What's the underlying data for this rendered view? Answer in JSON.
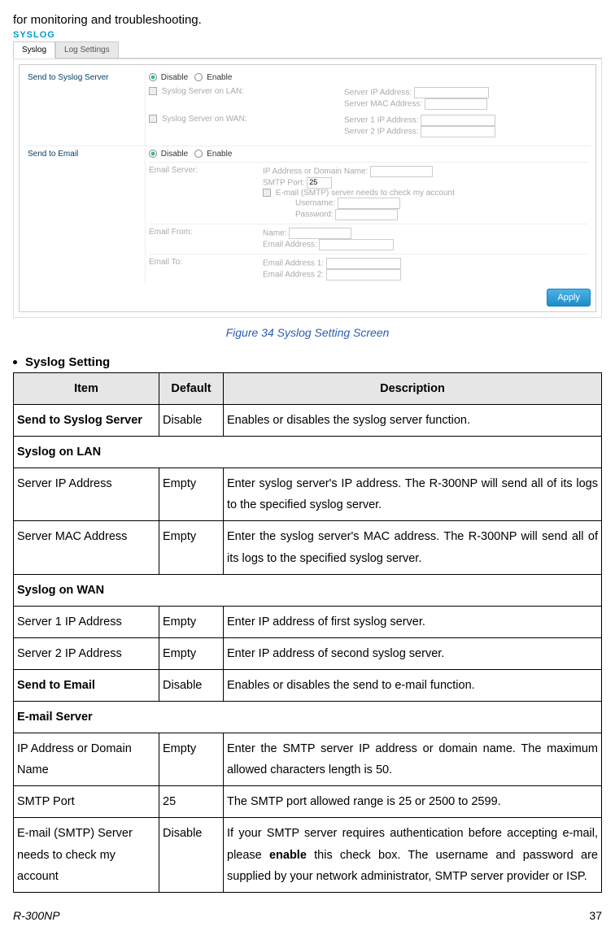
{
  "intro": "for monitoring and troubleshooting.",
  "syslogTitle": "SYSLOG",
  "tabs": {
    "syslog": "Syslog",
    "logSettings": "Log Settings"
  },
  "panel": {
    "sendToSyslogServer": "Send to Syslog Server",
    "disable": "Disable",
    "enable": "Enable",
    "syslogOnLAN": "Syslog Server on LAN:",
    "serverIP": "Server IP Address:",
    "serverMAC": "Server MAC Address:",
    "syslogOnWAN": "Syslog Server on WAN:",
    "server1IP": "Server 1 IP Address:",
    "server2IP": "Server 2 IP Address:",
    "sendToEmail": "Send to Email",
    "emailServer": "Email Server:",
    "ipOrDomain": "IP Address or Domain Name:",
    "smtpPort": "SMTP Port:",
    "smtpPortValue": "25",
    "smtpCheck": "E-mail (SMTP) server needs to check my account",
    "username": "Username:",
    "password": "Password:",
    "emailFrom": "Email From:",
    "name": "Name:",
    "emailAddress": "Email Address:",
    "emailTo": "Email To:",
    "emailAddr1": "Email Address 1:",
    "emailAddr2": "Email Address 2:",
    "apply": "Apply"
  },
  "figureCaption": "Figure 34 Syslog Setting Screen",
  "settingsHeading": "Syslog Setting",
  "headers": {
    "item": "Item",
    "default": "Default",
    "description": "Description"
  },
  "rows": {
    "r1": {
      "item": "Send to Syslog Server",
      "def": "Disable",
      "desc": "Enables or disables the syslog server function."
    },
    "s1": "Syslog on LAN",
    "r2": {
      "item": "Server IP Address",
      "def": "Empty",
      "desc": "Enter syslog server's IP address. The R-300NP will send all of its logs to the specified syslog server."
    },
    "r3": {
      "item": "Server MAC Address",
      "def": "Empty",
      "desc": "Enter the syslog server's MAC address. The R-300NP will send all of its logs to the specified syslog server."
    },
    "s2": "Syslog on WAN",
    "r4": {
      "item": "Server 1 IP Address",
      "def": "Empty",
      "desc": "Enter IP address of first syslog server."
    },
    "r5": {
      "item": "Server 2 IP Address",
      "def": "Empty",
      "desc": "Enter IP address of second syslog server."
    },
    "r6": {
      "item": "Send to Email",
      "def": "Disable",
      "desc": "Enables or disables the send to e-mail function."
    },
    "s3": "E-mail Server",
    "r7": {
      "item": "IP Address or Domain Name",
      "def": "Empty",
      "desc": "Enter the SMTP server IP address or domain name. The maximum allowed characters length is 50."
    },
    "r8": {
      "item": "SMTP Port",
      "def": "25",
      "desc": "The SMTP port allowed range is 25 or 2500 to 2599."
    },
    "r9_item": "E-mail (SMTP) Server needs to check my account",
    "r9_def": "Disable",
    "r9_desc_pre": "If your SMTP server requires authentication before accepting e-mail, please ",
    "r9_desc_bold": "enable",
    "r9_desc_post": " this check box. The username and password are supplied by your network administrator, SMTP server provider or ISP."
  },
  "footer": {
    "model": "R-300NP",
    "page": "37"
  }
}
